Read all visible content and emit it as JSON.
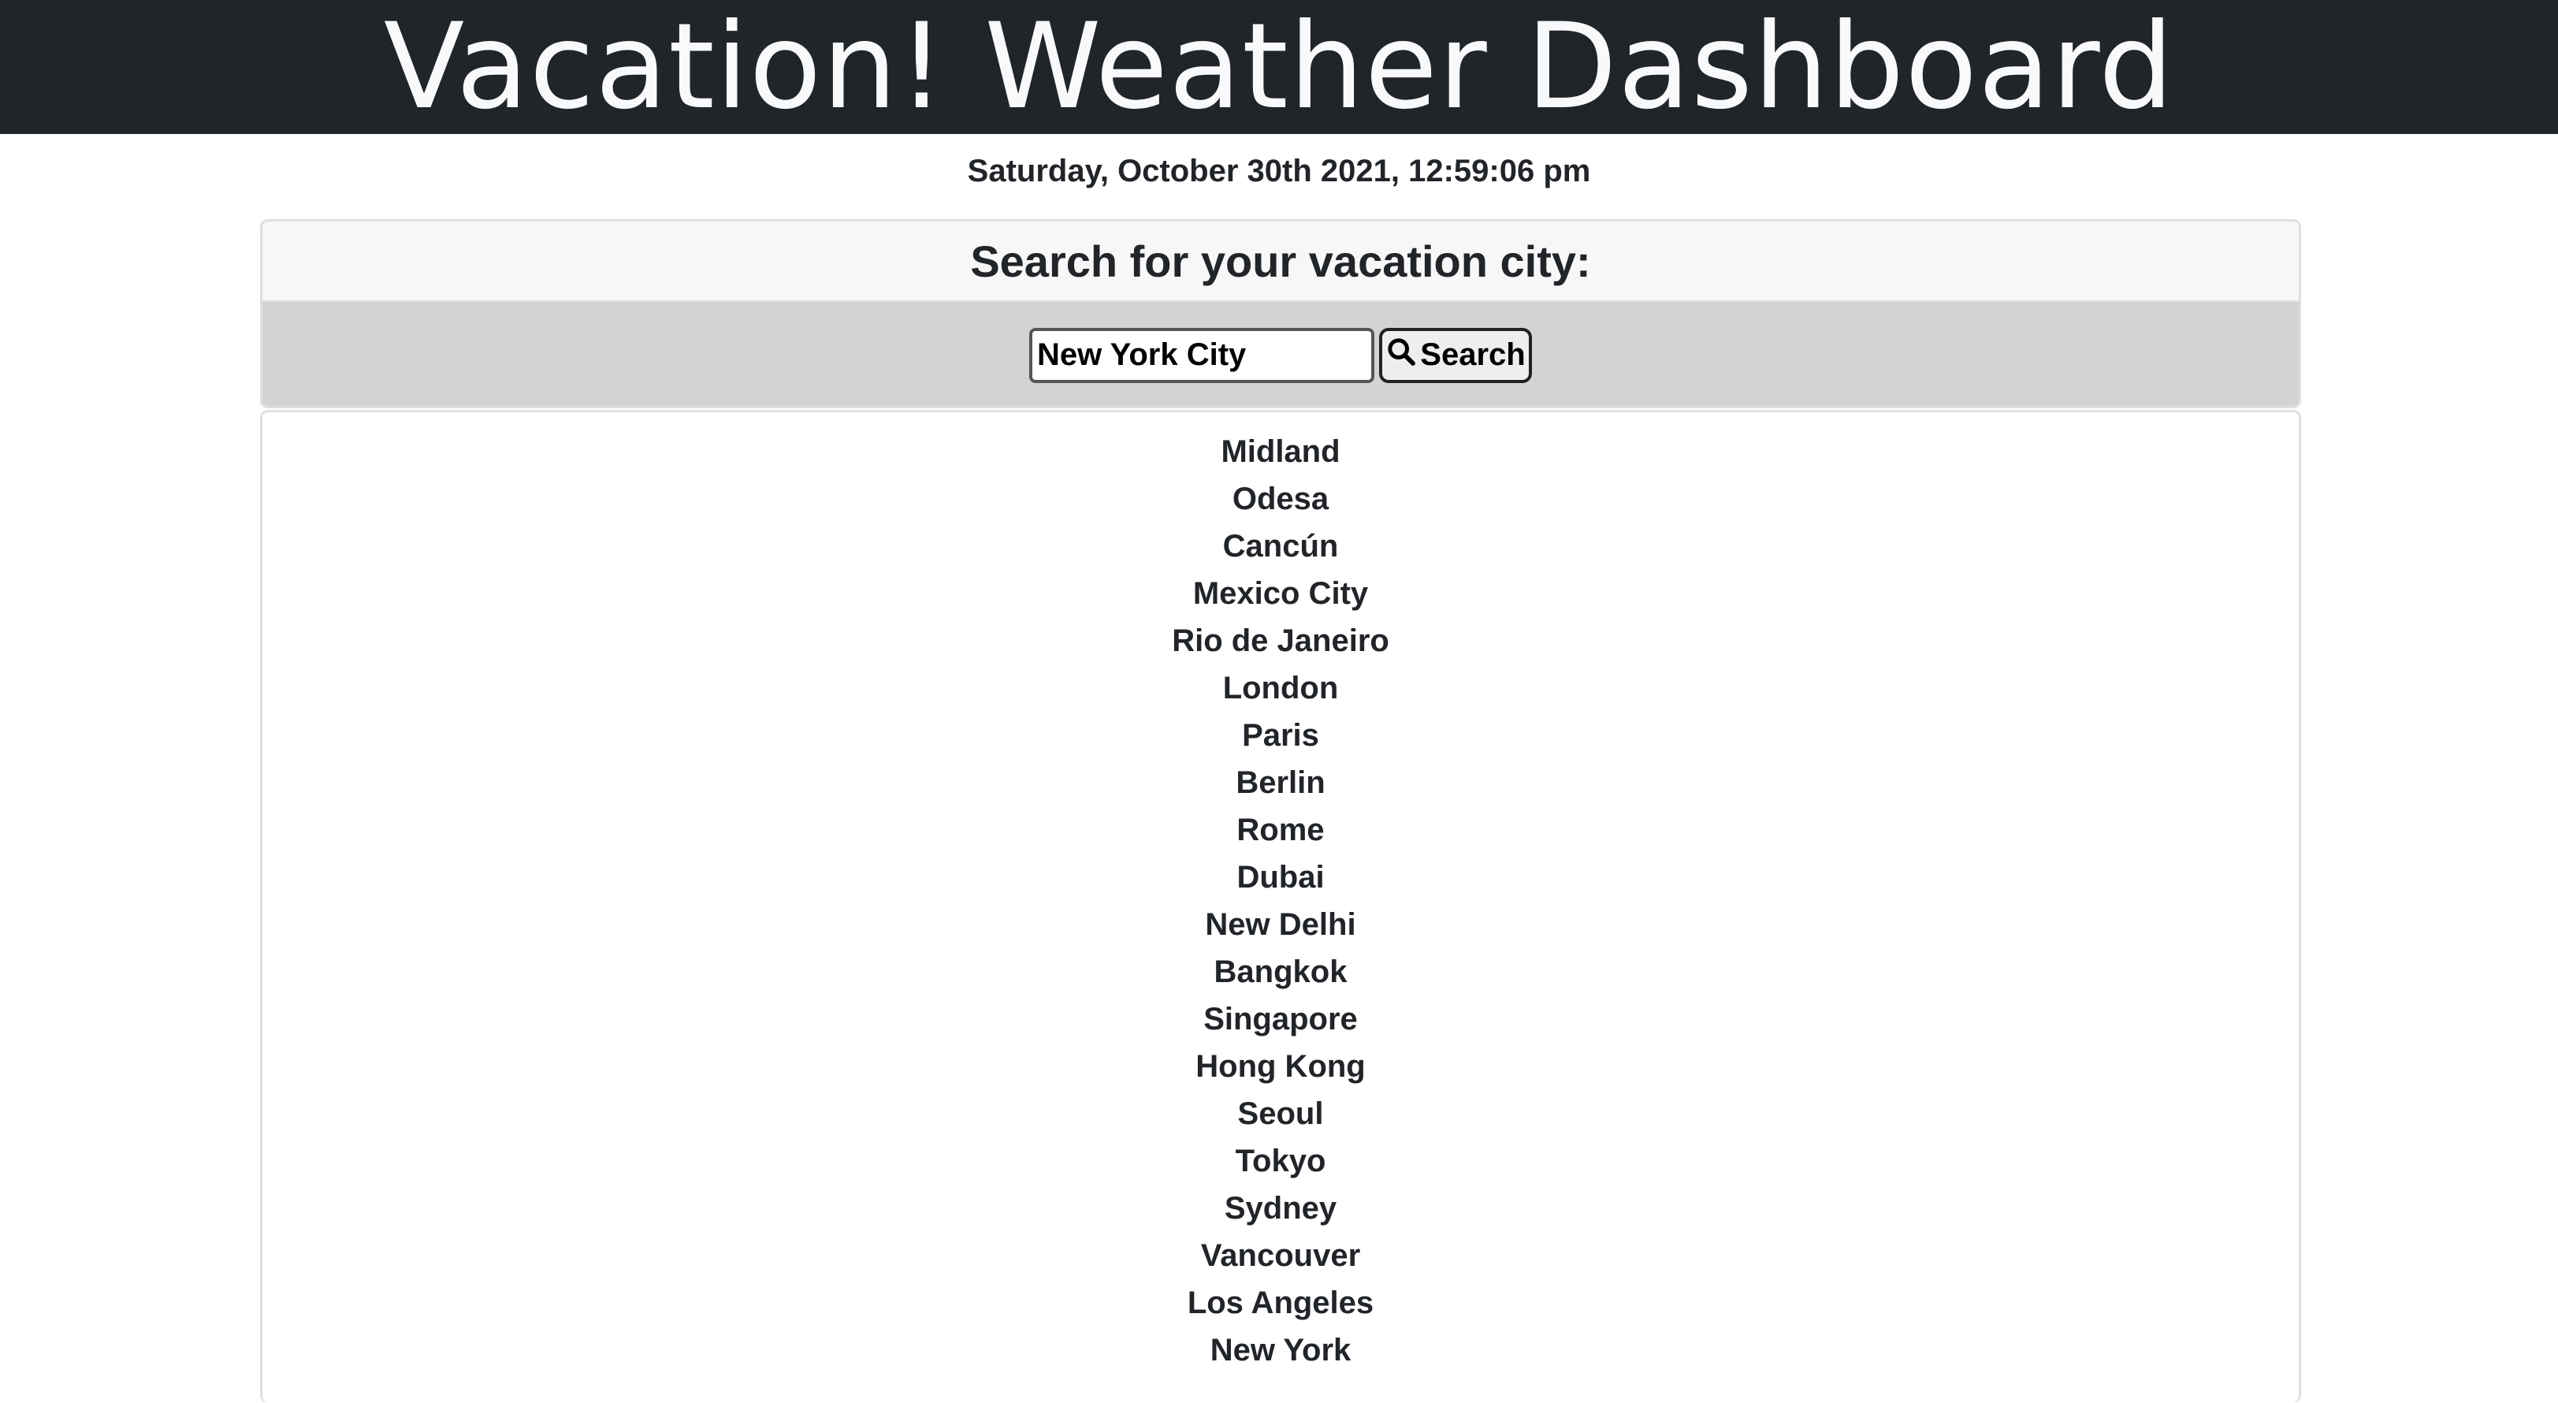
{
  "header": {
    "title": "Vacation! Weather Dashboard"
  },
  "datetime": "Saturday, October 30th 2021, 12:59:06 pm",
  "search": {
    "heading": "Search for your vacation city:",
    "input_value": "New York City",
    "button_label": "Search",
    "button_icon": "search-icon"
  },
  "cities": [
    "Midland",
    "Odesa",
    "Cancún",
    "Mexico City",
    "Rio de Janeiro",
    "London",
    "Paris",
    "Berlin",
    "Rome",
    "Dubai",
    "New Delhi",
    "Bangkok",
    "Singapore",
    "Hong Kong",
    "Seoul",
    "Tokyo",
    "Sydney",
    "Vancouver",
    "Los Angeles",
    "New York"
  ],
  "colors": {
    "header_bg": "#212529",
    "header_text": "#f8f9fa",
    "search_body_bg": "#d3d3d3",
    "card_header_bg": "#f7f7f7"
  }
}
